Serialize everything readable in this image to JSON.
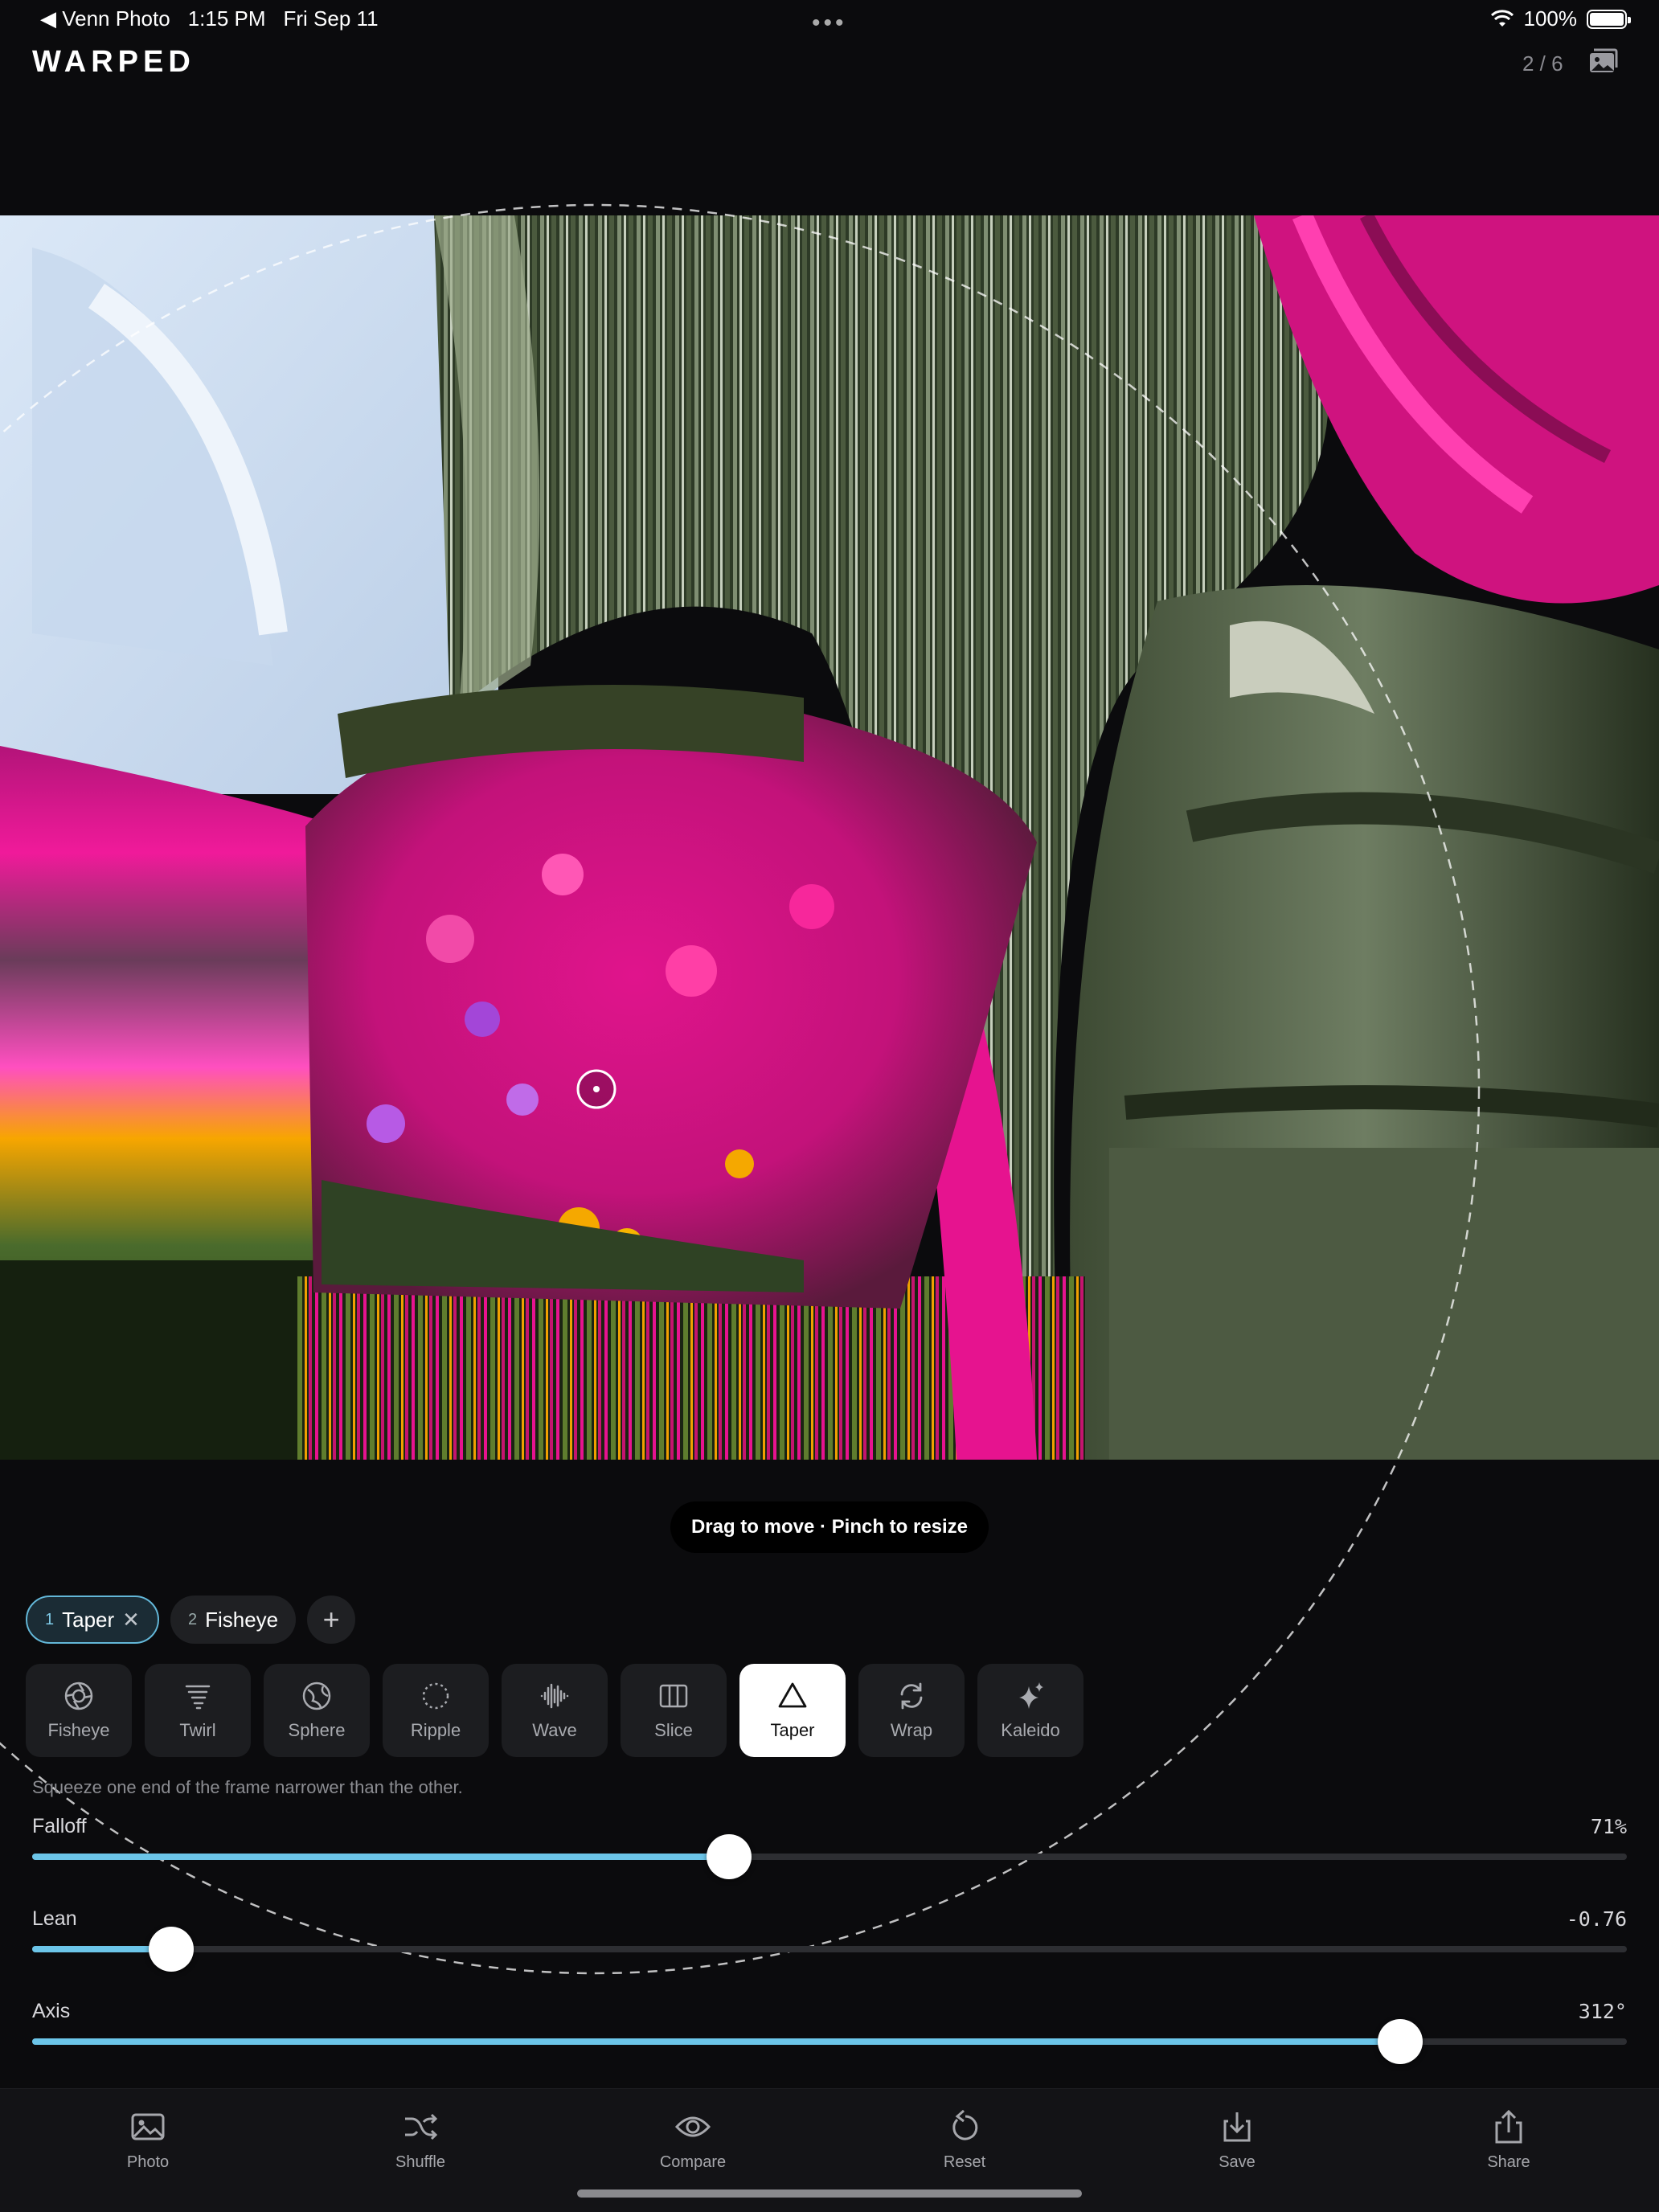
{
  "status_bar": {
    "back_app": "Venn Photo",
    "time": "1:15 PM",
    "date": "Fri Sep 11",
    "battery": "100%"
  },
  "header": {
    "brand": "WARPED",
    "counter": "2 / 6"
  },
  "canvas": {
    "hint": "Drag to move · Pinch to resize"
  },
  "layers": [
    {
      "index": "1",
      "name": "Taper",
      "active": true
    },
    {
      "index": "2",
      "name": "Fisheye",
      "active": false
    }
  ],
  "effects": [
    {
      "label": "Fisheye",
      "icon": "aperture-icon"
    },
    {
      "label": "Twirl",
      "icon": "tornado-icon"
    },
    {
      "label": "Sphere",
      "icon": "globe-icon"
    },
    {
      "label": "Ripple",
      "icon": "dotted-circle-icon"
    },
    {
      "label": "Wave",
      "icon": "waveform-icon"
    },
    {
      "label": "Slice",
      "icon": "columns-icon"
    },
    {
      "label": "Taper",
      "icon": "triangle-icon",
      "selected": true
    },
    {
      "label": "Wrap",
      "icon": "cycle-arrows-icon"
    },
    {
      "label": "Kaleido",
      "icon": "sparkles-icon"
    }
  ],
  "description": "Squeeze one end of the frame narrower than the other.",
  "sliders": [
    {
      "label": "Falloff",
      "value": "71%",
      "fraction": 0.437
    },
    {
      "label": "Lean",
      "value": "-0.76",
      "fraction": 0.087
    },
    {
      "label": "Axis",
      "value": "312°",
      "fraction": 0.858
    }
  ],
  "tabbar": [
    {
      "label": "Photo",
      "icon": "photo-icon"
    },
    {
      "label": "Shuffle",
      "icon": "shuffle-icon"
    },
    {
      "label": "Compare",
      "icon": "eye-icon"
    },
    {
      "label": "Reset",
      "icon": "reset-icon"
    },
    {
      "label": "Save",
      "icon": "download-icon"
    },
    {
      "label": "Share",
      "icon": "share-icon"
    }
  ],
  "colors": {
    "accent": "#6cc5e8",
    "background": "#0b0b0d",
    "magenta": "#e0148c",
    "foliage": "#4f5a45"
  }
}
